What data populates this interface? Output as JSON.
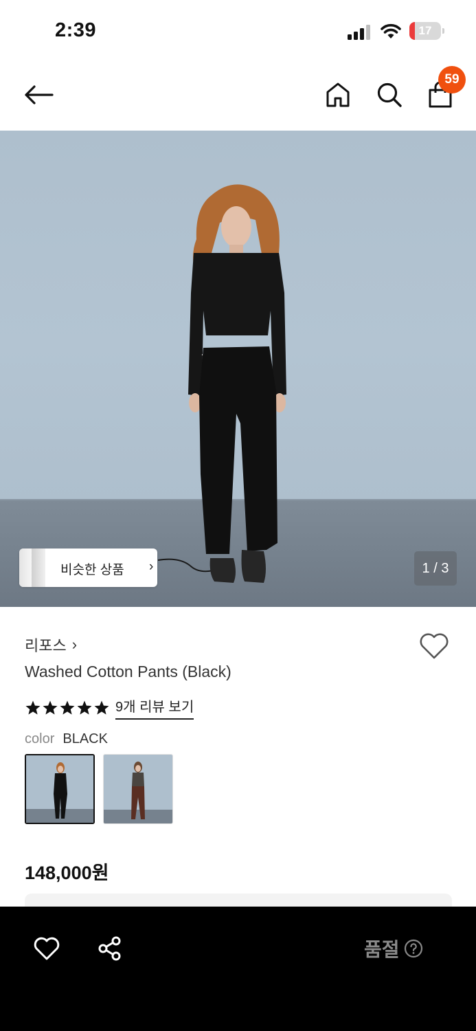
{
  "status_bar": {
    "time": "2:39",
    "battery_level": "17",
    "battery_fraction": 0.17,
    "icons": [
      "cellular-signal-icon",
      "wifi-icon",
      "battery-icon"
    ]
  },
  "header": {
    "icons": [
      "arrow-left-icon",
      "home-icon",
      "search-icon",
      "shopping-bag-icon"
    ],
    "cart_count": "59",
    "badge_color": "#f0500f"
  },
  "hero": {
    "similar_products_label": "비슷한 상품",
    "similar_chevron": "›",
    "page_indicator": "1 / 3"
  },
  "product": {
    "brand": "리포스",
    "brand_chevron": "›",
    "name": "Washed Cotton Pants (Black)",
    "rating_stars": 5,
    "review_link": "9개 리뷰 보기",
    "color_label": "color",
    "color_value": "BLACK",
    "price": "148,000원"
  },
  "bottom_bar": {
    "icons": [
      "heart-icon",
      "share-icon",
      "help-circle-icon"
    ],
    "status_label": "품절",
    "background": "#000000"
  }
}
